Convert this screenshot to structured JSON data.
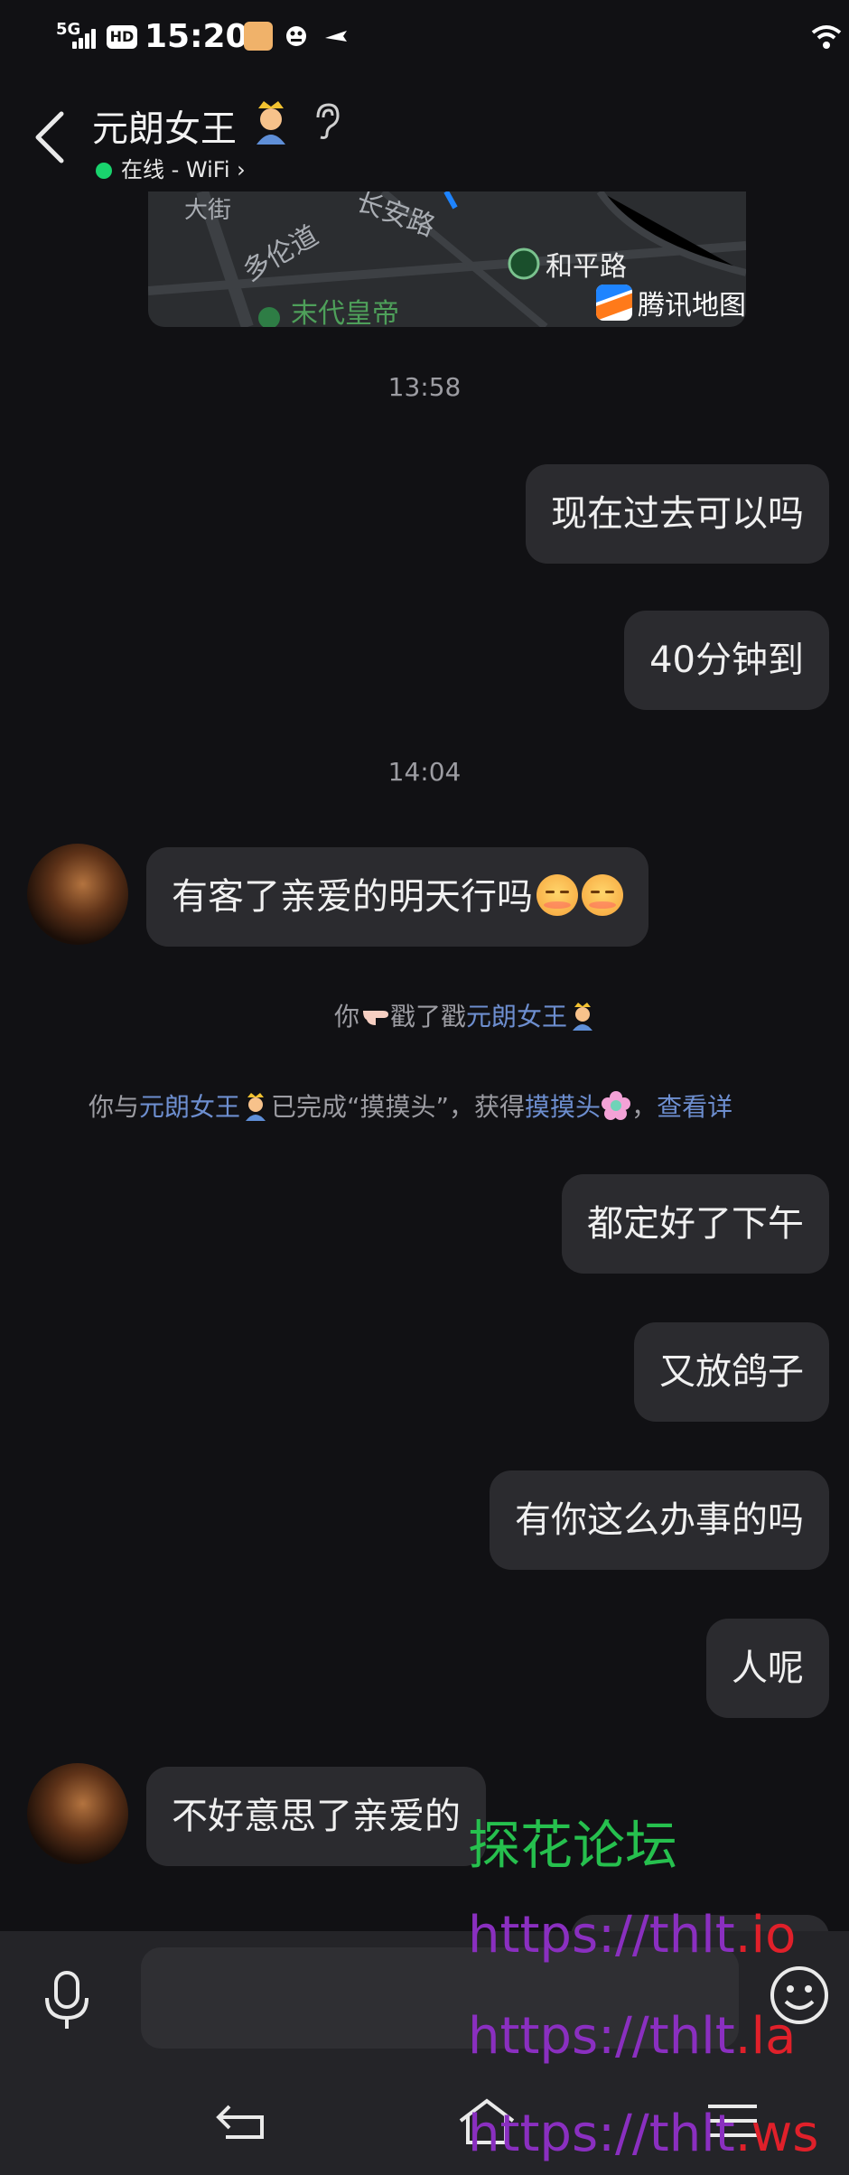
{
  "status_bar": {
    "network": "5G",
    "hd": "HD",
    "time": "15:20"
  },
  "header": {
    "title": "元朗女王",
    "presence": "在线 - WiFi ›"
  },
  "map": {
    "labels": [
      "大街",
      "多伦道",
      "长安路",
      "和平路",
      "末代皇帝"
    ],
    "provider": "腾讯地图"
  },
  "messages": [
    {
      "type": "timestamp",
      "text": "13:58"
    },
    {
      "type": "sent",
      "text": "现在过去可以吗"
    },
    {
      "type": "sent",
      "text": "40分钟到"
    },
    {
      "type": "timestamp",
      "text": "14:04"
    },
    {
      "type": "received",
      "text": "有客了亲爱的明天行吗"
    },
    {
      "type": "system",
      "prefix": "你",
      "action": "戳了戳",
      "target": "元朗女王"
    },
    {
      "type": "system",
      "prefix": "你与",
      "target": "元朗女王",
      "middle": "已完成“摸摸头”，获得",
      "reward": "摸摸头",
      "sep": "，",
      "link": "查看详"
    },
    {
      "type": "sent",
      "text": "都定好了下午"
    },
    {
      "type": "sent",
      "text": "又放鸽子"
    },
    {
      "type": "sent",
      "text": "有你这么办事的吗"
    },
    {
      "type": "sent",
      "text": "人呢"
    },
    {
      "type": "received",
      "text": "不好意思了亲爱的"
    }
  ],
  "watermark": {
    "title": "探花论坛",
    "urls": [
      {
        "prefix": "https://thlt",
        "suffix": ".io"
      },
      {
        "prefix": "https://thlt",
        "suffix": ".la"
      },
      {
        "prefix": "https://thlt",
        "suffix": ".ws"
      }
    ]
  },
  "input": {
    "value": ""
  },
  "colors": {
    "background": "#111114",
    "bubble": "#2b2b2f",
    "online": "#19d36d",
    "link": "#6d8ecf",
    "watermark_green": "#26c04e",
    "watermark_purple": "#8a2fc0",
    "watermark_red": "#e0202a"
  },
  "icons": {
    "back": "chevron-left-icon",
    "ear": "ear-icon",
    "mic": "microphone-icon",
    "emoji": "smiley-icon",
    "nav": [
      "back-nav-icon",
      "home-nav-icon",
      "menu-nav-icon"
    ]
  }
}
